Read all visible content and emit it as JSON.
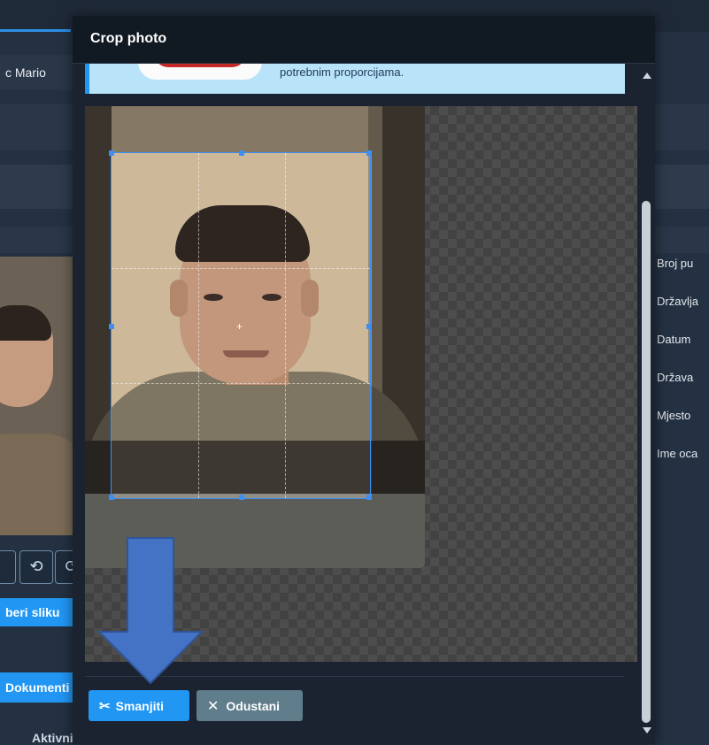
{
  "background": {
    "user_name": "c Mario",
    "select_image_label": "beri sliku",
    "documents_tab": "Dokumenti",
    "active_label": "Aktivni",
    "side_labels": [
      "Broj pu",
      "Državlja",
      "Datum",
      "Država",
      "Mjesto",
      "Ime oca"
    ],
    "rotate_left_icon": "rotate-left-icon",
    "rotate_right_icon": "rotate-right-icon"
  },
  "modal": {
    "title": "Crop photo",
    "info_text": "potrebnim proporcijama.",
    "crop_button": "Smanjiti",
    "crop_button_icon": "scissors-icon",
    "cancel_button": "Odustani",
    "cancel_button_icon": "close-icon"
  },
  "colors": {
    "primary": "#2196f3",
    "secondary": "#607d8b",
    "modal_header": "#111923",
    "info_box": "#b9e3f8",
    "annotation_arrow": "#4472c4"
  }
}
